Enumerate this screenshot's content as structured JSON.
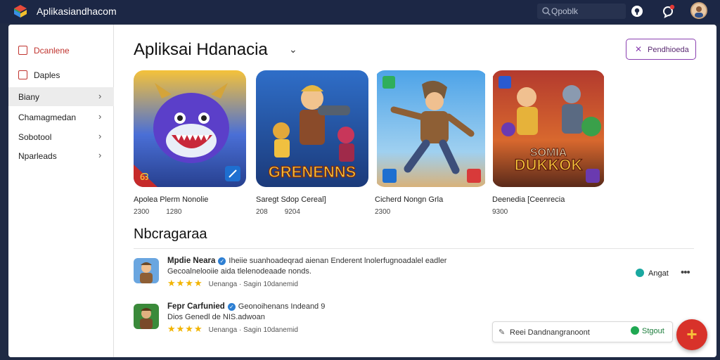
{
  "app": {
    "title": "Aplikasiandhacom"
  },
  "search": {
    "placeholder": "Qpoblk"
  },
  "sidebar": {
    "top_items": [
      {
        "label": "Dcanlene"
      },
      {
        "label": "Daples"
      }
    ],
    "items": [
      {
        "label": "Biany"
      },
      {
        "label": "Chamagmedan"
      },
      {
        "label": "Sobotool"
      },
      {
        "label": "Nparleads"
      }
    ]
  },
  "main": {
    "title": "Apliksai Hdanacia",
    "top_button": "Pendhioeda",
    "apps": [
      {
        "name": "Apolea Plerm Nonolie",
        "meta1": "2300",
        "meta2": "1280"
      },
      {
        "name": "Saregt Sdop Cereal]",
        "meta1": "208",
        "meta2": "9204"
      },
      {
        "name": "Cicherd Nongn Grla",
        "meta1": "2300",
        "meta2": ""
      },
      {
        "name": "Deenedia [Ceenrecia",
        "meta1": "9300",
        "meta2": ""
      }
    ],
    "thumb_texts": {
      "app2": "GRENENNS",
      "app4_line1": "SOMIA",
      "app4_line2": "DUKKOK"
    },
    "section_title": "Nbcragaraa",
    "reviews": [
      {
        "name": "Mpdie Neara",
        "line1": "Iheiie suanhoadeqrad aienan Enderent lnolerfugnoadalel eadler",
        "line2": "Gecoalnelooiie aida tlelenodeaade nonds.",
        "rating": "Uenanga",
        "extra": "Sagin 10danemid"
      },
      {
        "name": "Fepr Carfunied",
        "line1": "Geonoihenans Indeand 9",
        "line2": "Dios Genedl de NIS.adwoan",
        "rating": "Uenanga",
        "extra": "Sagin 10danemid"
      }
    ],
    "review_action": "Angat",
    "compose_placeholder": "Reei Dandnangranoont",
    "compose_send": "Stgout"
  },
  "colors": {
    "accent": "#8a3fb0",
    "topbar": "#1c2745",
    "star": "#f2b400",
    "fab": "#d8322a"
  }
}
